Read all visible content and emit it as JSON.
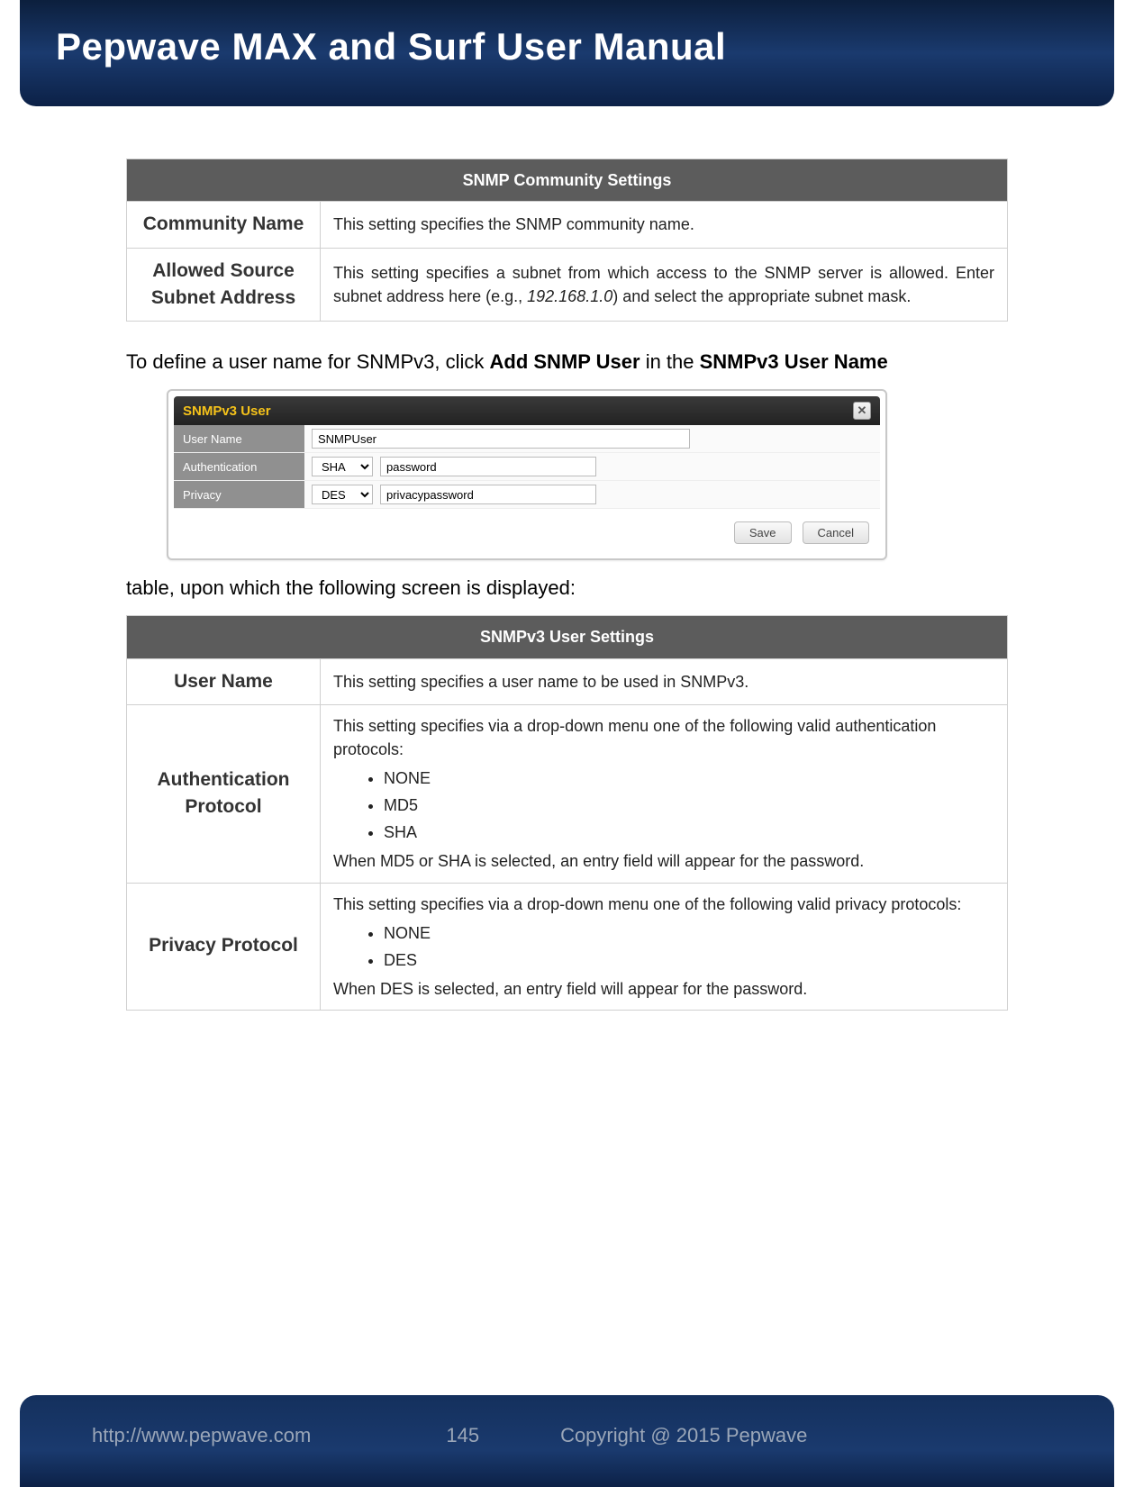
{
  "header": {
    "title": "Pepwave MAX and Surf User Manual"
  },
  "tables": {
    "snmp_community": {
      "title": "SNMP Community Settings",
      "rows": [
        {
          "label": "Community Name",
          "desc": "This setting specifies the SNMP community name."
        },
        {
          "label": "Allowed Source Subnet Address",
          "desc_pre": "This setting specifies a subnet from which access to the SNMP server is allowed. Enter subnet address here (e.g., ",
          "desc_em": "192.168.1.0",
          "desc_post": ") and select the appropriate subnet mask."
        }
      ]
    },
    "snmpv3_user": {
      "title": "SNMPv3 User Settings",
      "rows": [
        {
          "label": "User Name",
          "desc": "This setting specifies a user name to be used in SNMPv3."
        },
        {
          "label": "Authentication Protocol",
          "desc_pre": "This setting specifies via a drop-down menu one of the following valid authentication protocols:",
          "bullets": [
            "NONE",
            "MD5",
            "SHA"
          ],
          "desc_post": "When MD5 or SHA is selected, an entry field will appear for the password."
        },
        {
          "label": "Privacy Protocol",
          "desc_pre": "This setting specifies via a drop-down menu one of the following valid privacy protocols:",
          "bullets": [
            "NONE",
            "DES"
          ],
          "desc_post": "When DES is selected, an entry field will appear for the password."
        }
      ]
    }
  },
  "para1": {
    "pre": "To define a user name for SNMPv3, click ",
    "b1": "Add SNMP User",
    "mid": " in the ",
    "b2": "SNMPv3 User Name"
  },
  "para2": "table, upon which the following screen is displayed:",
  "dialog": {
    "title": "SNMPv3 User",
    "close": "✕",
    "rows": {
      "username": {
        "label": "User Name",
        "value": "SNMPUser"
      },
      "auth": {
        "label": "Authentication",
        "select": "SHA",
        "value": "password"
      },
      "privacy": {
        "label": "Privacy",
        "select": "DES",
        "value": "privacypassword"
      }
    },
    "save": "Save",
    "cancel": "Cancel"
  },
  "footer": {
    "url": "http://www.pepwave.com",
    "page": "145",
    "copyright": "Copyright @ 2015 Pepwave"
  }
}
